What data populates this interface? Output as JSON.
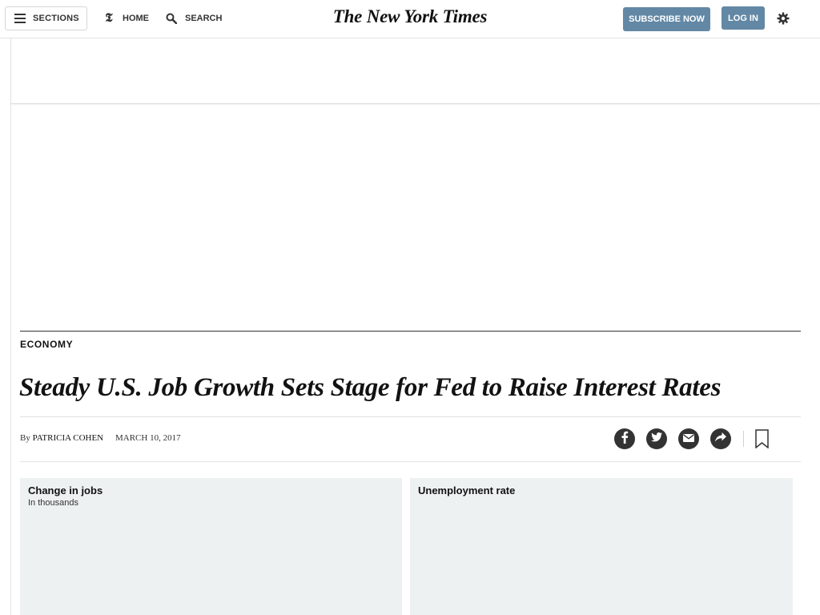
{
  "header": {
    "sections_label": "SECTIONS",
    "home_label": "HOME",
    "search_label": "SEARCH",
    "logo_text": "The New York Times",
    "subscribe_label": "SUBSCRIBE NOW",
    "login_label": "LOG IN",
    "icons": {
      "sections": "hamburger-icon",
      "home": "nyt-t-logo-icon",
      "search": "search-icon",
      "settings": "gear-icon"
    },
    "button_color": "#6288a5"
  },
  "article": {
    "kicker": "ECONOMY",
    "headline": "Steady U.S. Job Growth Sets Stage for Fed to Raise Interest Rates",
    "byline_prefix": "By",
    "author": "PATRICIA COHEN",
    "date": "MARCH 10, 2017",
    "share_icons": [
      "facebook-icon",
      "twitter-icon",
      "email-icon",
      "share-more-icon",
      "bookmark-icon"
    ]
  },
  "charts": {
    "jobs": {
      "title": "Change in jobs",
      "subtitle": "In thousands"
    },
    "unemployment": {
      "title": "Unemployment rate"
    },
    "panel_color": "#edf1f2"
  }
}
